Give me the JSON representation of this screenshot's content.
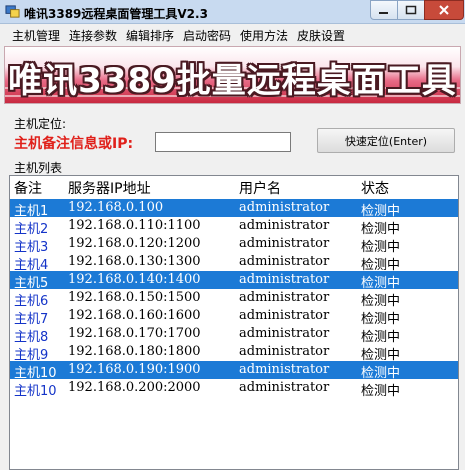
{
  "window": {
    "title": "唯讯3389远程桌面管理工具V2.3",
    "icon": "app-icon"
  },
  "menu": [
    "主机管理",
    "连接参数",
    "编辑排序",
    "启动密码",
    "使用方法",
    "皮肤设置"
  ],
  "banner": {
    "text": "唯讯3389批量远程桌面工具"
  },
  "locate": {
    "group_label": "主机定位:",
    "field_label": "主机备注信息或IP:",
    "input_value": "",
    "button_label": "快速定位(Enter)"
  },
  "host_list": {
    "group_label": "主机列表",
    "columns": [
      "备注",
      "服务器IP地址",
      "用户名",
      "状态"
    ],
    "rows": [
      {
        "note": "主机1",
        "ip": "192.168.0.100",
        "user": "administrator",
        "status": "检测中",
        "selected": true
      },
      {
        "note": "主机2",
        "ip": "192.168.0.110:1100",
        "user": "administrator",
        "status": "检测中",
        "selected": false
      },
      {
        "note": "主机3",
        "ip": "192.168.0.120:1200",
        "user": "administrator",
        "status": "检测中",
        "selected": false
      },
      {
        "note": "主机4",
        "ip": "192.168.0.130:1300",
        "user": "administrator",
        "status": "检测中",
        "selected": false
      },
      {
        "note": "主机5",
        "ip": "192.168.0.140:1400",
        "user": "administrator",
        "status": "检测中",
        "selected": true
      },
      {
        "note": "主机6",
        "ip": "192.168.0.150:1500",
        "user": "administrator",
        "status": "检测中",
        "selected": false
      },
      {
        "note": "主机7",
        "ip": "192.168.0.160:1600",
        "user": "administrator",
        "status": "检测中",
        "selected": false
      },
      {
        "note": "主机8",
        "ip": "192.168.0.170:1700",
        "user": "administrator",
        "status": "检测中",
        "selected": false
      },
      {
        "note": "主机9",
        "ip": "192.168.0.180:1800",
        "user": "administrator",
        "status": "检测中",
        "selected": false
      },
      {
        "note": "主机10",
        "ip": "192.168.0.190:1900",
        "user": "administrator",
        "status": "检测中",
        "selected": true
      },
      {
        "note": "主机10",
        "ip": "192.168.0.200:2000",
        "user": "administrator",
        "status": "检测中",
        "selected": false
      }
    ]
  },
  "colors": {
    "selection": "#1c7ad6",
    "host_name": "#1434c8",
    "required_label": "#e0201a",
    "close_button": "#c74a3a"
  }
}
